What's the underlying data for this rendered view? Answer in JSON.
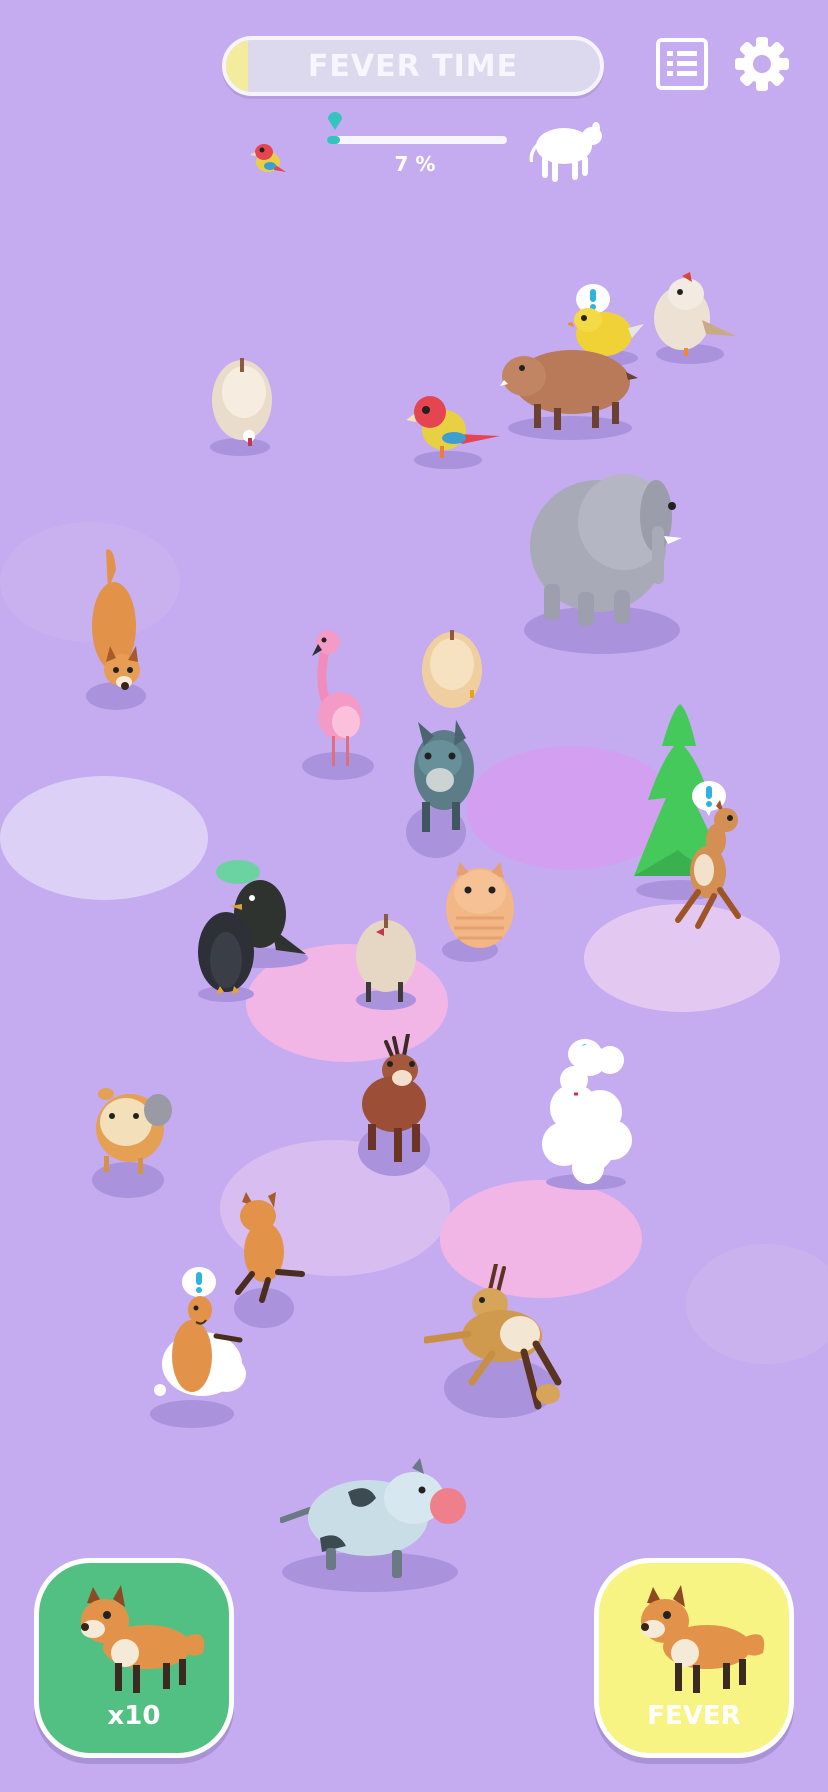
{
  "hud": {
    "fever_label": "FEVER TIME",
    "fever_progress": 0.06,
    "progress_text": "7 %",
    "progress_value": 0.07,
    "start_animal": "parrot",
    "goal_animal": "cow-silhouette",
    "menu_icon": "list-icon",
    "settings_icon": "gear-icon"
  },
  "buttons": {
    "spawn_label": "x10",
    "fever_label": "FEVER",
    "spawn_animal": "fox",
    "fever_animal": "fox"
  },
  "animals": [
    "parrot",
    "hamster",
    "chicken",
    "yellow-chick",
    "warthog",
    "elephant",
    "fox",
    "flamingo",
    "hamster",
    "donkey",
    "pine-tree",
    "deer",
    "penguin",
    "crow",
    "pig",
    "cat",
    "chicken",
    "moose",
    "sheep",
    "guinea-pig",
    "fox",
    "gazelle",
    "llama",
    "cow"
  ],
  "colors": {
    "background": "#c5abef",
    "spawn_button": "#53c083",
    "fever_button": "#f7f484",
    "progress_fill": "#35c3c0",
    "alert_mark": "#2fb3de"
  }
}
